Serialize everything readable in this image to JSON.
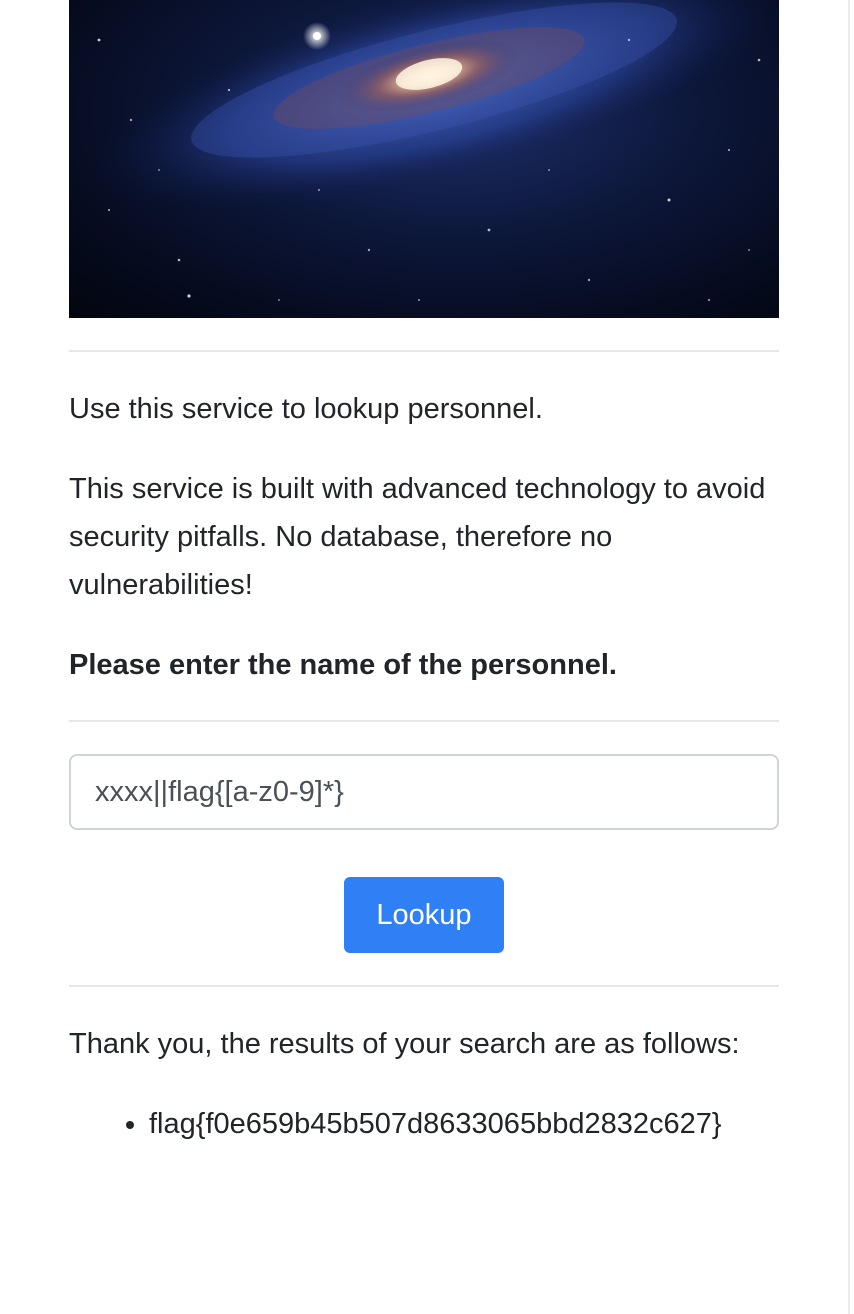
{
  "intro": {
    "line1": "Use this service to lookup personnel.",
    "line2": "This service is built with advanced technology to avoid security pitfalls. No database, therefore no vulnerabilities!",
    "prompt": "Please enter the name of the personnel."
  },
  "form": {
    "input_value": "xxxx||flag{[a-z0-9]*}",
    "button_label": "Lookup"
  },
  "results": {
    "heading": "Thank you, the results of your search are as follows:",
    "items": [
      "flag{f0e659b45b507d8633065bbd2832c627}"
    ]
  },
  "colors": {
    "accent": "#2f80f5",
    "text": "#212529",
    "divider": "#e4e6e8"
  }
}
